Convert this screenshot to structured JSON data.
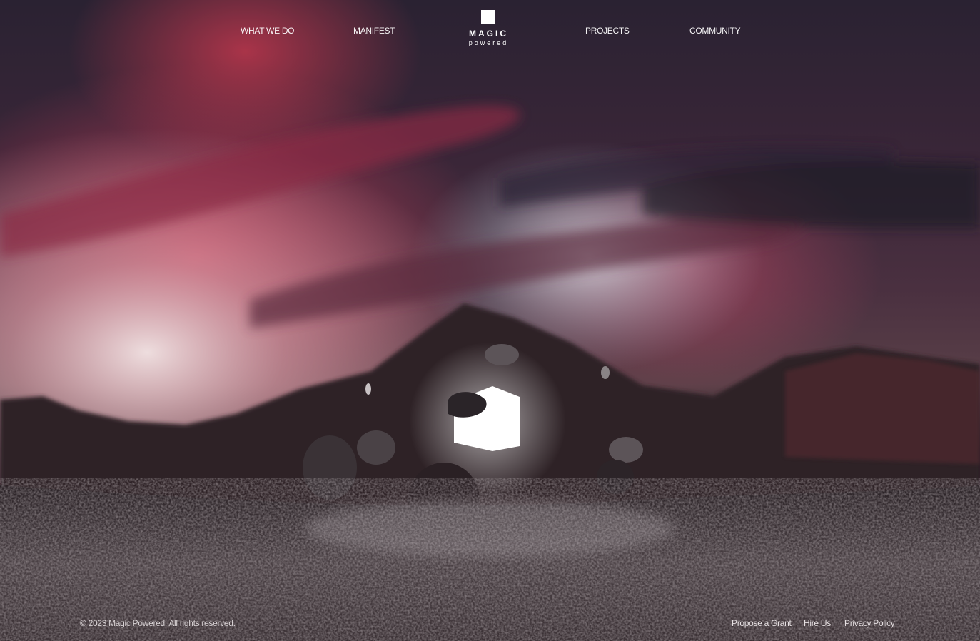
{
  "nav": {
    "items": [
      {
        "label": "WHAT WE DO"
      },
      {
        "label": "MANIFEST"
      },
      {
        "label": "PROJECTS"
      },
      {
        "label": "COMMUNITY"
      }
    ]
  },
  "logo": {
    "word": "MAGIC",
    "sub": "powered"
  },
  "footer": {
    "copyright": "© 2023 Magic Powered. All rights reserved.",
    "links": [
      {
        "label": "Propose a Grant"
      },
      {
        "label": "Hire Us"
      },
      {
        "label": "Privacy Policy"
      }
    ]
  },
  "colors": {
    "sky_red": "#b0304c",
    "sky_dark": "#2a2032",
    "glow": "#ffffff",
    "ground": "#3a3236"
  }
}
